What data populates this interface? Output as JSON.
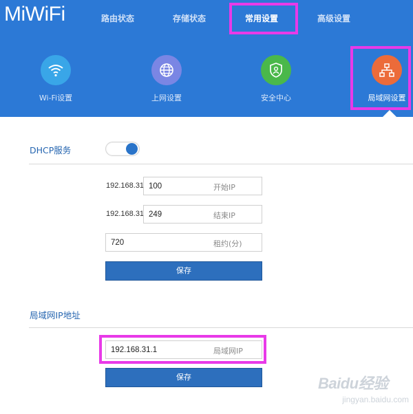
{
  "brand": {
    "logo": "MiWiFi"
  },
  "top_nav": {
    "tabs": [
      {
        "label": "路由状态"
      },
      {
        "label": "存储状态"
      },
      {
        "label": "常用设置",
        "active": true
      },
      {
        "label": "高级设置"
      }
    ]
  },
  "sub_nav": {
    "items": [
      {
        "label": "Wi-Fi设置",
        "icon": "wifi-icon",
        "color": "#39a6e8"
      },
      {
        "label": "上网设置",
        "icon": "globe-icon",
        "color": "#7a86e4"
      },
      {
        "label": "安全中心",
        "icon": "shield-icon",
        "color": "#4ab84a"
      },
      {
        "label": "局域网设置",
        "icon": "network-icon",
        "color": "#ec6b3a",
        "active": true
      }
    ]
  },
  "dhcp": {
    "title": "DHCP服务",
    "enabled": true,
    "ip_prefix": "192.168.31",
    "start_value": "100",
    "start_hint": "开始IP",
    "end_value": "249",
    "end_hint": "结束IP",
    "lease_value": "720",
    "lease_hint": "租约(分)",
    "save_label": "保存"
  },
  "lan_ip": {
    "title": "局域网IP地址",
    "value": "192.168.31.1",
    "hint": "局域网IP",
    "save_label": "保存"
  },
  "watermark": {
    "line1": "Baidu经验",
    "line2": "jingyan.baidu.com"
  },
  "colors": {
    "header": "#2c79d6",
    "accent": "#2565b0",
    "highlight": "#e83ae8",
    "button": "#2d6fbd"
  }
}
